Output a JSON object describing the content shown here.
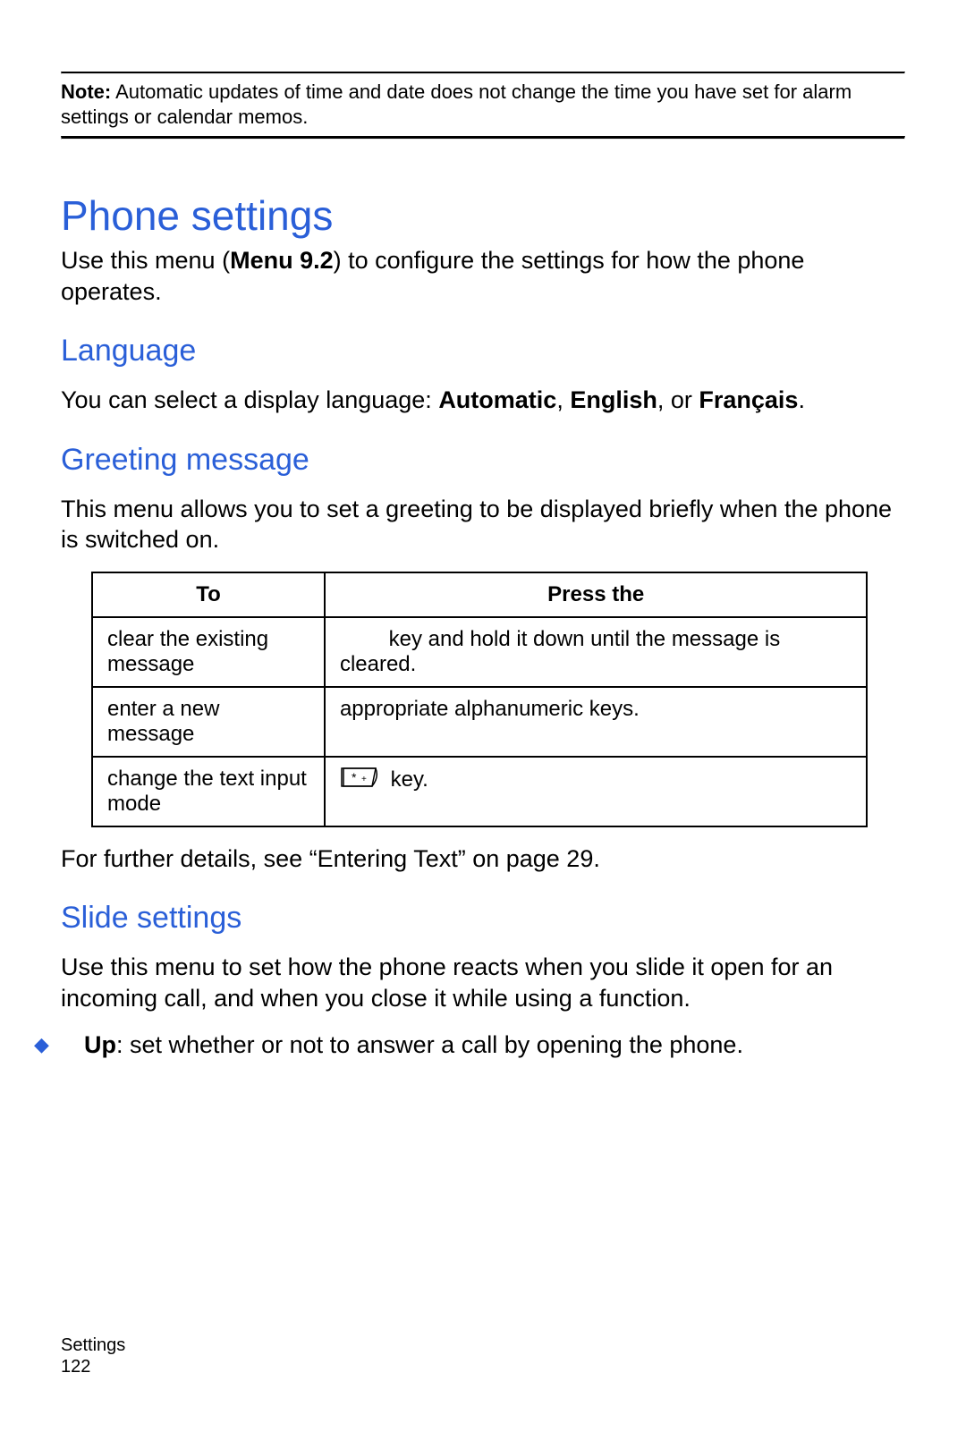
{
  "note": {
    "label": "Note:",
    "text": " Automatic updates of time and date does not change the time you have set for alarm settings or calendar memos."
  },
  "h1": "Phone settings",
  "intro_pre": "Use this menu (",
  "intro_bold": "Menu 9.2",
  "intro_post": ") to configure the settings for how the phone operates.",
  "language": {
    "heading": "Language",
    "pre": "You can select a display language: ",
    "opt1": "Automatic",
    "sep1": ", ",
    "opt2": "English",
    "sep2": ", or ",
    "opt3": "Français",
    "post": "."
  },
  "greeting": {
    "heading": "Greeting message",
    "intro": "This menu allows you to set a greeting to be displayed briefly when the phone is switched on.",
    "table": {
      "head_to": "To",
      "head_press": "Press the",
      "rows": [
        {
          "to": "clear the existing message",
          "press_prefix": "",
          "press_rest": " key and hold it down until the message is cleared."
        },
        {
          "to": "enter a new message",
          "press_prefix": "",
          "press_rest": "appropriate alphanumeric keys."
        },
        {
          "to": "change the text input mode",
          "press_prefix": "",
          "press_rest": " key."
        }
      ]
    },
    "after": "For further details, see “Entering Text” on page 29."
  },
  "slide": {
    "heading": "Slide settings",
    "intro": "Use this menu to set how the phone reacts when you slide it open for an incoming call, and when you close it while using a function.",
    "bullet_bold": "Up",
    "bullet_rest": ": set whether or not to answer a call by opening the phone."
  },
  "footer": {
    "section": "Settings",
    "page": "122"
  },
  "chart_data": {
    "type": "table",
    "title": "Greeting message key actions",
    "columns": [
      "To",
      "Press the"
    ],
    "rows": [
      [
        "clear the existing message",
        "key and hold it down until the message is cleared."
      ],
      [
        "enter a new message",
        "appropriate alphanumeric keys."
      ],
      [
        "change the text input mode",
        "[*] key."
      ]
    ]
  }
}
